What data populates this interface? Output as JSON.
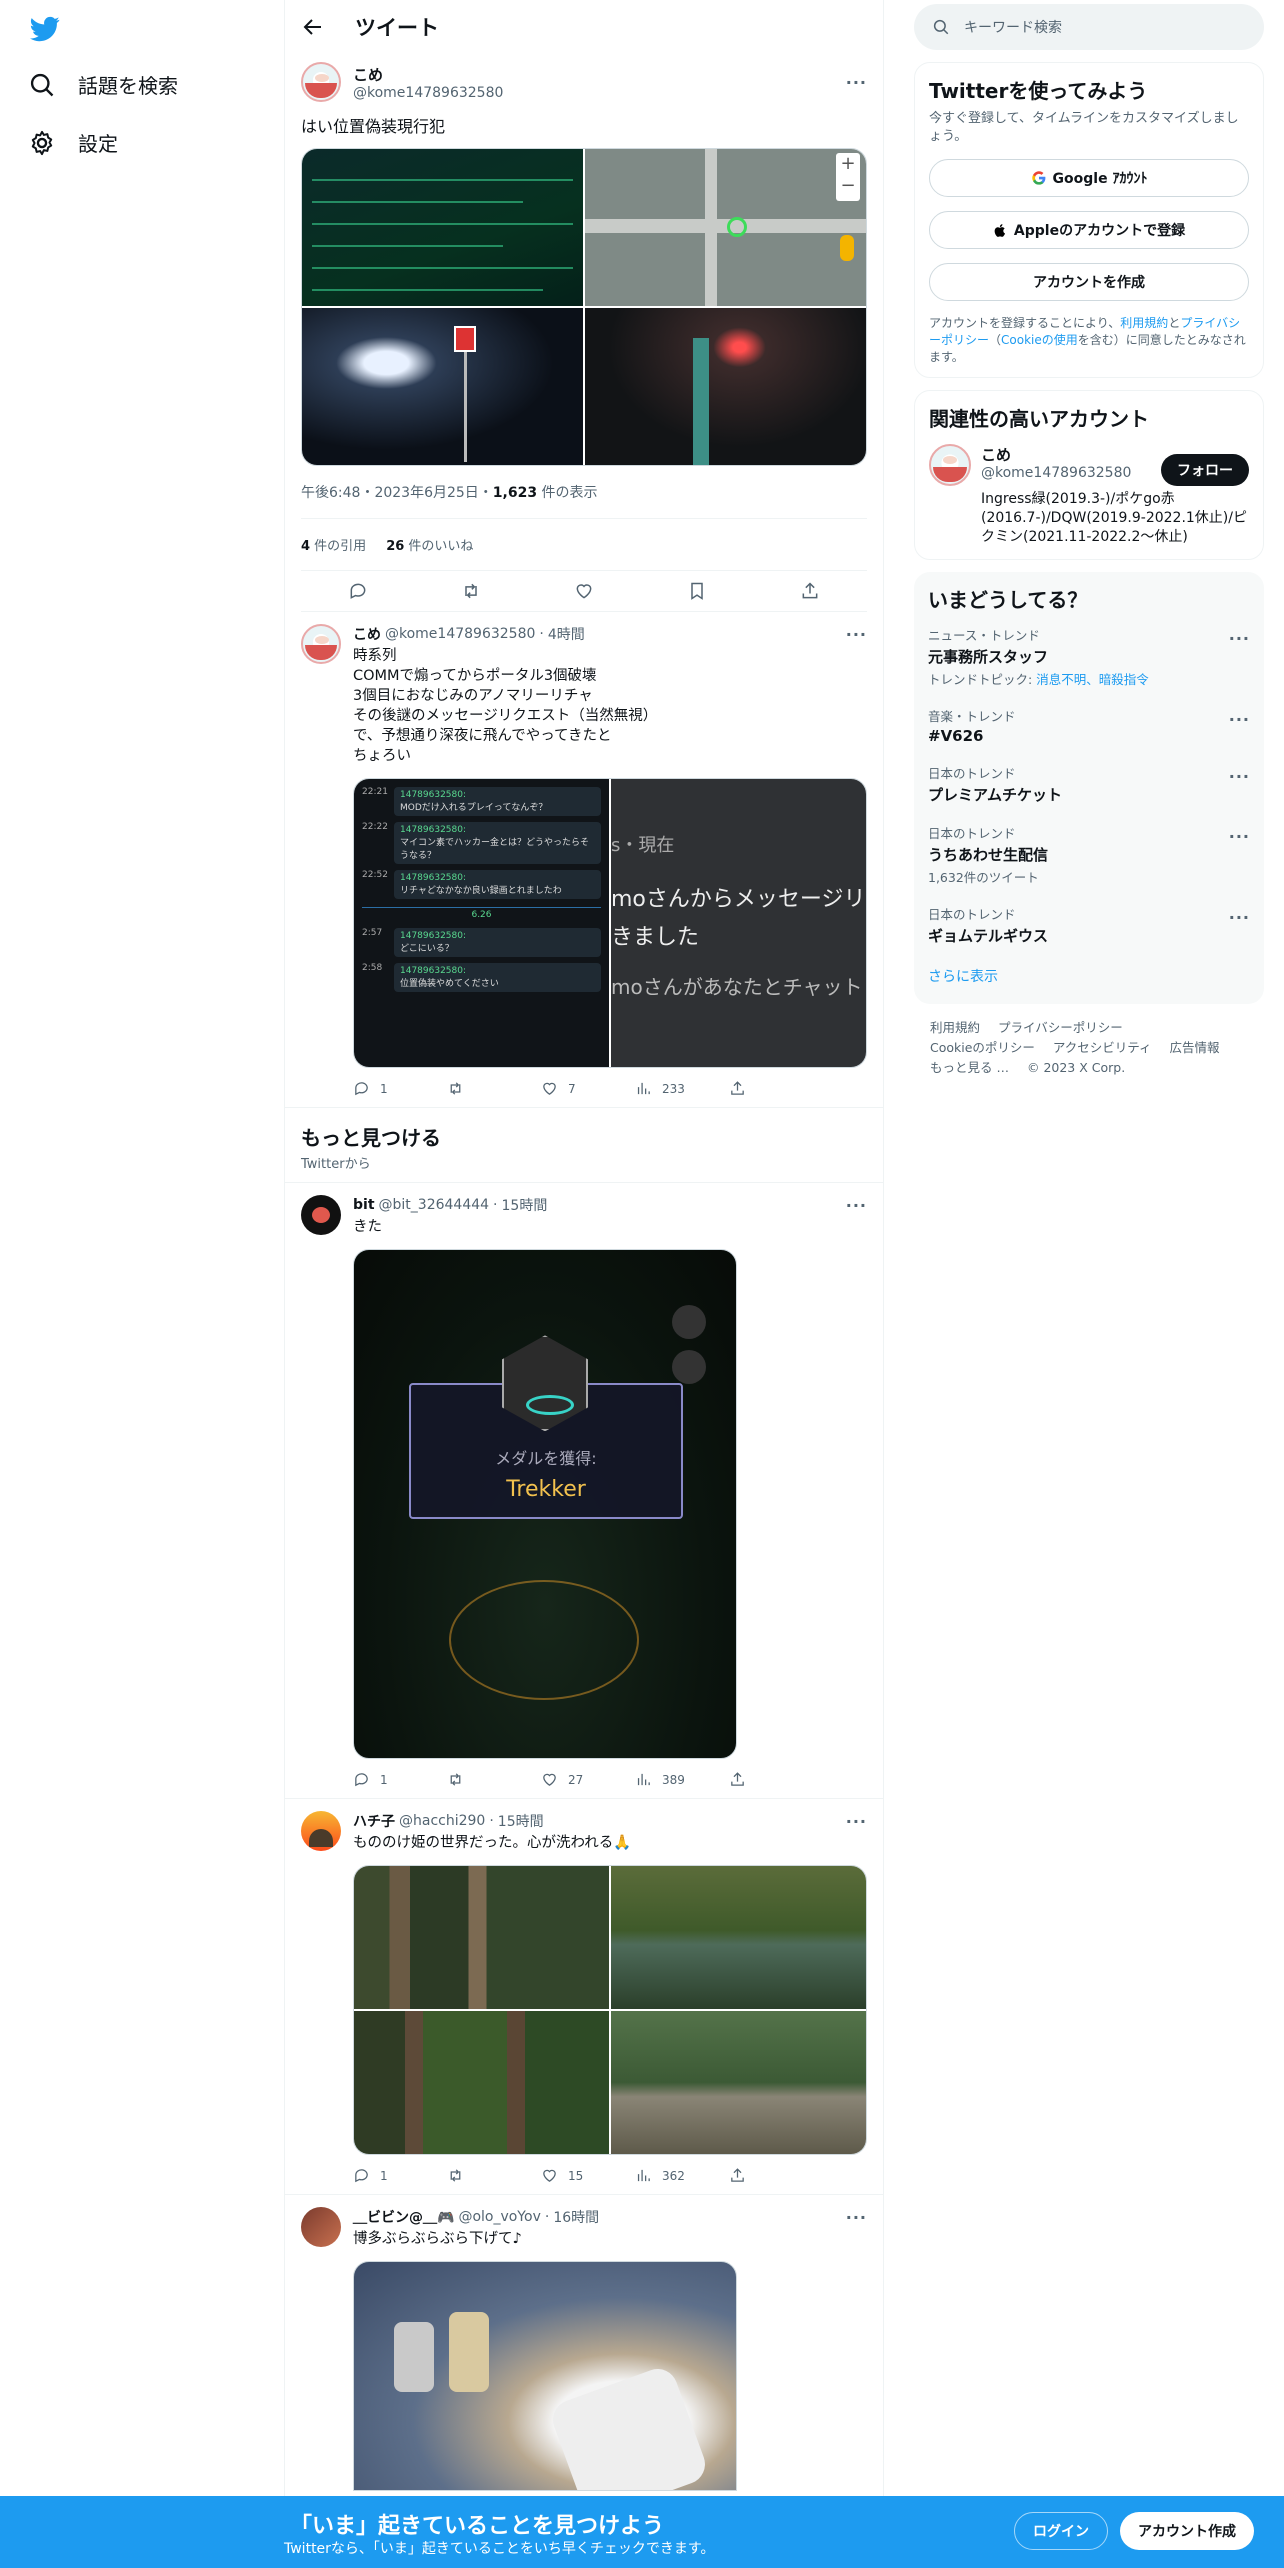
{
  "nav": {
    "items": [
      {
        "label": "話題を検索",
        "icon": "search-icon"
      },
      {
        "label": "設定",
        "icon": "gear-icon"
      }
    ]
  },
  "header": {
    "title": "ツイート"
  },
  "main_tweet": {
    "name": "こめ",
    "handle": "@kome14789632580",
    "text": "はい位置偽装現行犯",
    "timestamp": "午後6:48・2023年6月25日・",
    "views_count": "1,623",
    "views_label": " 件の表示",
    "quotes_count": "4",
    "quotes_label": " 件の引用",
    "likes_count": "26",
    "likes_label": " 件のいいね"
  },
  "reply": {
    "name": "こめ",
    "handle": "@kome14789632580",
    "time": "4時間",
    "text": "時系列\nCOMMで煽ってからポータル3個破壊\n3個目におなじみのアノマリーリチャ\nその後謎のメッセージリクエスト（当然無視）\nで、予想通り深夜に飛んでやってきたと\nちょろい",
    "chat": [
      {
        "time": "22:21",
        "user": "14789632580:",
        "text": "MODだけ入れるプレイってなんぞ？"
      },
      {
        "time": "22:22",
        "user": "14789632580:",
        "text": "マイコン素でハッカー金とは？どうやったらそうなる？"
      },
      {
        "time": "22:52",
        "user": "14789632580:",
        "text": "リチャどなかなか良い録画とれましたわ"
      },
      {
        "time": "2:57",
        "user": "14789632580:",
        "text": "どこにいる？"
      },
      {
        "time": "2:58",
        "user": "14789632580:",
        "text": "位置偽装やめてください"
      }
    ],
    "chat_divider": "6.26",
    "msg_line1": "s・現在",
    "msg_line2": "moさんからメッセージリク",
    "msg_line3": "きました",
    "msg_line4": "moさんがあなたとチャットし",
    "replies": "1",
    "retweets": "",
    "likes": "7",
    "views": "233"
  },
  "discover": {
    "title": "もっと見つける",
    "subtitle": "Twitterから"
  },
  "tweets": [
    {
      "name": "bit",
      "handle": "@bit_32644444",
      "time": "15時間",
      "text": "きた",
      "medal_label": "メダルを獲得:",
      "medal_name": "Trekker",
      "replies": "1",
      "retweets": "",
      "likes": "27",
      "views": "389"
    },
    {
      "name": "ハチ子",
      "handle": "@hacchi290",
      "time": "15時間",
      "text": "もののけ姫の世界だった。心が洗われる🙏",
      "replies": "1",
      "retweets": "",
      "likes": "15",
      "views": "362"
    },
    {
      "name": "＿ビビン@＿🎮",
      "handle": "@olo_voYov",
      "time": "16時間",
      "text": "博多ぶらぶらぶら下げて♪"
    }
  ],
  "search": {
    "placeholder": "キーワード検索"
  },
  "signup_card": {
    "title": "Twitterを使ってみよう",
    "subtitle": "今すぐ登録して、タイムラインをカスタマイズしましょう。",
    "google": "Google ｱｶｳﾝﾄ",
    "apple": "Appleのアカウントで登録",
    "create": "アカウントを作成",
    "legal_1": "アカウントを登録することにより、",
    "legal_terms": "利用規約",
    "legal_2": "と",
    "legal_privacy": "プライバシーポリシー",
    "legal_3": "（",
    "legal_cookie": "Cookieの使用",
    "legal_4": "を含む）に同意したとみなされます。"
  },
  "related": {
    "title": "関連性の高いアカウント",
    "name": "こめ",
    "handle": "@kome14789632580",
    "bio": "Ingress緑(2019.3-)/ポケgo赤(2016.7-)/DQW(2019.9-2022.1休止)/ピクミン(2021.11-2022.2〜休止)",
    "follow": "フォロー"
  },
  "trends": {
    "title": "いまどうしてる？",
    "items": [
      {
        "context": "ニュース・トレンド",
        "name": "元事務所スタッフ",
        "extra_prefix": "トレンドトピック: ",
        "extra_link": "消息不明、暗殺指令"
      },
      {
        "context": "音楽・トレンド",
        "name": "#V626",
        "extra_prefix": "",
        "extra_link": ""
      },
      {
        "context": "日本のトレンド",
        "name": "プレミアムチケット",
        "extra_prefix": "",
        "extra_link": ""
      },
      {
        "context": "日本のトレンド",
        "name": "うちあわせ生配信",
        "extra_prefix": "1,632件のツイート",
        "extra_link": ""
      },
      {
        "context": "日本のトレンド",
        "name": "ギョムテルギウス",
        "extra_prefix": "",
        "extra_link": ""
      }
    ],
    "show_more": "さらに表示"
  },
  "footer": {
    "links": [
      "利用規約",
      "プライバシーポリシー",
      "Cookieのポリシー",
      "アクセシビリティ",
      "広告情報",
      "もっと見る …",
      "© 2023 X Corp."
    ]
  },
  "bottom_bar": {
    "title": "「いま」起きていることを見つけよう",
    "subtitle": "Twitterなら、「いま」起きていることをいち早くチェックできます。",
    "login": "ログイン",
    "signup": "アカウント作成"
  },
  "colors": {
    "accent": "#1d9bf0",
    "text": "#0f1419",
    "muted": "#536471"
  }
}
